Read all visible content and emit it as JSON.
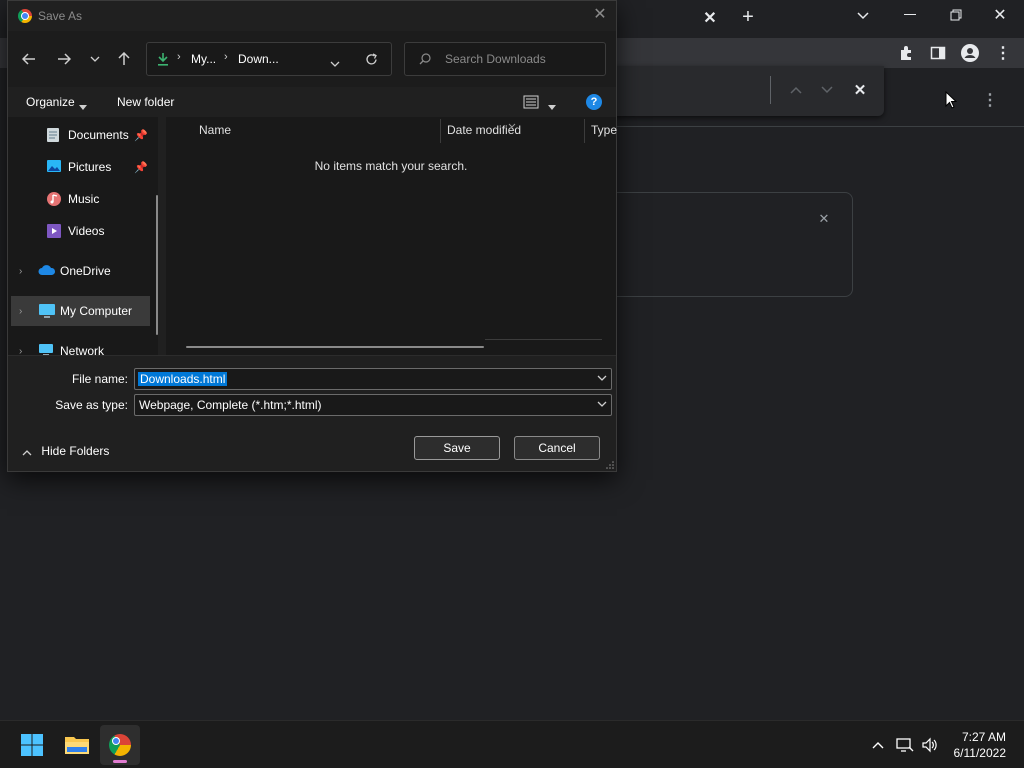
{
  "dialog": {
    "title": "Save As",
    "address": {
      "segment1": "My...",
      "segment2": "Down..."
    },
    "search_placeholder": "Search Downloads",
    "commands": {
      "organize": "Organize",
      "new_folder": "New folder"
    },
    "nav_items": [
      {
        "label": "Documents",
        "icon": "documents-icon",
        "pinned": true
      },
      {
        "label": "Pictures",
        "icon": "pictures-icon",
        "pinned": true
      },
      {
        "label": "Music",
        "icon": "music-icon",
        "pinned": false
      },
      {
        "label": "Videos",
        "icon": "videos-icon",
        "pinned": false
      },
      {
        "label": "OneDrive",
        "icon": "onedrive-icon",
        "expandable": true
      },
      {
        "label": "My Computer",
        "icon": "computer-icon",
        "expandable": true,
        "selected": true
      },
      {
        "label": "Network",
        "icon": "network-icon",
        "expandable": true
      }
    ],
    "columns": [
      "Name",
      "Date modified",
      "Type"
    ],
    "empty_message": "No items match your search.",
    "file_name_label": "File name:",
    "file_name_value": "Downloads.html",
    "save_type_label": "Save as type:",
    "save_type_value": "Webpage, Complete (*.htm;*.html)",
    "save_button": "Save",
    "cancel_button": "Cancel",
    "hide_folders": "Hide Folders"
  },
  "taskbar": {
    "time": "7:27 AM",
    "date": "6/11/2022",
    "apps": [
      "start-icon",
      "file-explorer-icon",
      "chrome-icon"
    ]
  },
  "colors": {
    "accent": "#0078d7",
    "dialog_bg": "#202020",
    "chrome_bg": "#202124"
  }
}
